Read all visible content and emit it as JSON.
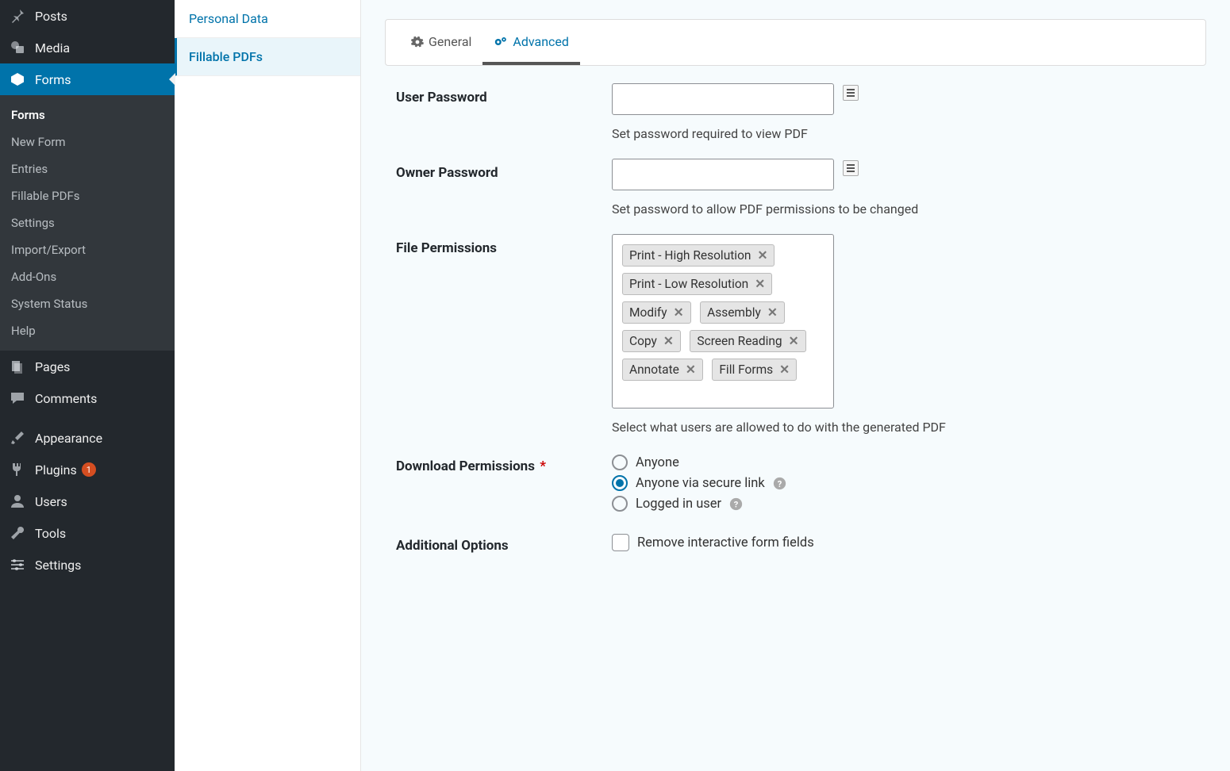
{
  "sidebar": {
    "items": [
      {
        "label": "Posts"
      },
      {
        "label": "Media"
      },
      {
        "label": "Forms",
        "active": true
      },
      {
        "label": "Pages"
      },
      {
        "label": "Comments"
      },
      {
        "label": "Appearance"
      },
      {
        "label": "Plugins",
        "badge": "1"
      },
      {
        "label": "Users"
      },
      {
        "label": "Tools"
      },
      {
        "label": "Settings"
      }
    ],
    "sub": [
      {
        "label": "Forms",
        "current": true
      },
      {
        "label": "New Form"
      },
      {
        "label": "Entries"
      },
      {
        "label": "Fillable PDFs"
      },
      {
        "label": "Settings"
      },
      {
        "label": "Import/Export"
      },
      {
        "label": "Add-Ons"
      },
      {
        "label": "System Status"
      },
      {
        "label": "Help"
      }
    ]
  },
  "subnav": {
    "items": [
      {
        "label": "Personal Data"
      },
      {
        "label": "Fillable PDFs",
        "active": true
      }
    ]
  },
  "tabs": {
    "general": "General",
    "advanced": "Advanced"
  },
  "fields": {
    "user_password": {
      "label": "User Password",
      "value": "",
      "help": "Set password required to view PDF"
    },
    "owner_password": {
      "label": "Owner Password",
      "value": "",
      "help": "Set password to allow PDF permissions to be changed"
    },
    "file_permissions": {
      "label": "File Permissions",
      "tags": [
        "Print - High Resolution",
        "Print - Low Resolution",
        "Modify",
        "Assembly",
        "Copy",
        "Screen Reading",
        "Annotate",
        "Fill Forms"
      ],
      "help": "Select what users are allowed to do with the generated PDF"
    },
    "download_permissions": {
      "label": "Download Permissions",
      "required": "*",
      "options": [
        {
          "label": "Anyone",
          "checked": false,
          "help": false
        },
        {
          "label": "Anyone via secure link",
          "checked": true,
          "help": true
        },
        {
          "label": "Logged in user",
          "checked": false,
          "help": true
        }
      ]
    },
    "additional_options": {
      "label": "Additional Options",
      "checkbox_label": "Remove interactive form fields"
    }
  }
}
